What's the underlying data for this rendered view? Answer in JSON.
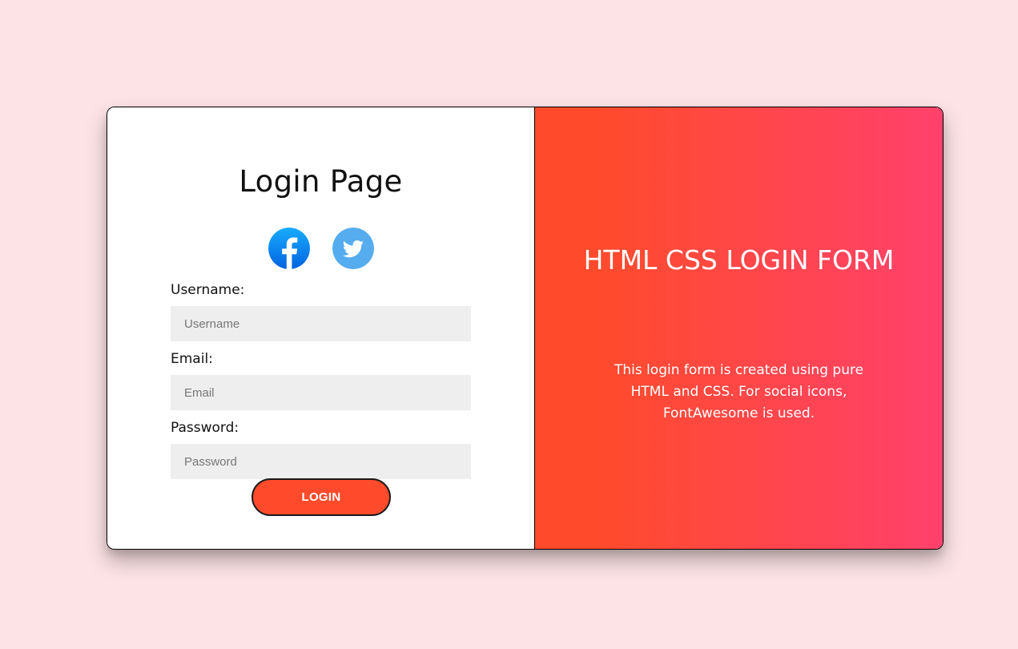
{
  "colors": {
    "page_background": "#fde3e6",
    "accent": "#ff4b2b",
    "gradient_end": "#ff416c",
    "facebook": "#1877f2",
    "twitter": "#55acee",
    "input_background": "#eeeeee"
  },
  "login": {
    "title": "Login Page",
    "social_icons": [
      "facebook-icon",
      "twitter-icon"
    ],
    "username_label": "Username:",
    "username_placeholder": "Username",
    "email_label": "Email:",
    "email_placeholder": "Email",
    "password_label": "Password:",
    "password_placeholder": "Password",
    "button_label": "LOGIN"
  },
  "info": {
    "title": "HTML CSS LOGIN FORM",
    "description": "This login form is created using pure HTML and CSS. For social icons, FontAwesome is used."
  }
}
